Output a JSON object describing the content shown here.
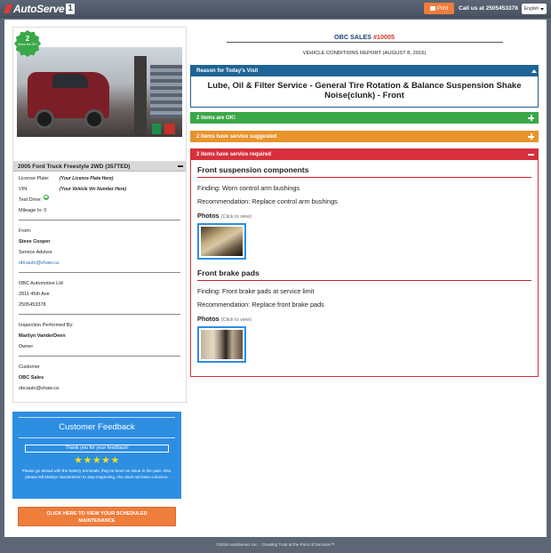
{
  "header": {
    "logo_text": "AutoServe",
    "logo_badge": "1",
    "print_label": "Print",
    "call_text": "Call us at 2505453378",
    "language": "English"
  },
  "vehicle_photo": {
    "ok_badge_count": "2",
    "ok_badge_text": "items are OK!"
  },
  "vehicle": {
    "title": "2005 Ford Truck Freestyle 2WD (357TED)",
    "license_label": "License Plate:",
    "license_value": "(Your Licence Plate Here)",
    "vin_label": "VIN:",
    "vin_value": "(Your Vehicle Vin Number Here)",
    "test_drive_label": "Test Drive:",
    "mileage_label": "Mileage In: 0",
    "from_label": "From:",
    "advisor_name": "Steve Cooper",
    "advisor_role": "Service Advisor",
    "advisor_email": "obcauto@shaw.ca",
    "shop_name": "OBC Automotive Ltd",
    "shop_address": "2811 45th Ave",
    "shop_phone": "2505453378",
    "inspector_label": "Inspection Performed By:",
    "inspector_name": "Marilyn VanderDeen",
    "inspector_role": "Owner",
    "customer_label": "Customer",
    "customer_name": "OBC Sales",
    "customer_email": "obcauto@shaw.ca"
  },
  "feedback": {
    "title": "Customer Feedback",
    "thanks": "Thank you for your feedback!",
    "stars": "★★★★★",
    "rating": 5,
    "message": "Please go ahead with the battery terminals, they've been an issue in the past. Also, please tell Marilyn VanderDeen to stop inspecting, she does not have a licence."
  },
  "maintenance_button": {
    "line1": "CLICK HERE TO VIEW YOUR SCHEDULED",
    "line2": "MAINTENANCE"
  },
  "report": {
    "title_prefix": "OBC SALES",
    "title_number": "#10005",
    "subtitle": "VEHICLE CONDITIONS REPORT (AUGUST 8, 2016)"
  },
  "reason": {
    "header": "Reason for Today's Visit",
    "text_line1": "Lube, Oil & Filter Service - General Tire Rotation & Balance Suspension Shake",
    "text_line2": "Noise(clunk) - Front"
  },
  "sections": {
    "ok": "2 items are OK!",
    "suggested": "2 items have service suggested",
    "required": "2 items have service required"
  },
  "items": [
    {
      "title": "Front suspension components",
      "finding": "Finding: Worn control arm bushings",
      "recommendation": "Recommendation: Replace control arm bushings",
      "photos_label": "Photos",
      "photos_hint": "(Click to view)"
    },
    {
      "title": "Front brake pads",
      "finding": "Finding: Front brake pads at service limit",
      "recommendation": "Recommendation: Replace front brake pads",
      "photos_label": "Photos",
      "photos_hint": "(Click to view)"
    }
  ],
  "footer": {
    "text": "©2016 AutoServe1 Inc. - Creating Trust at the Point of Decision™"
  },
  "colors": {
    "reason": "#1f6496",
    "ok": "#3aa848",
    "suggested": "#e8932c",
    "required": "#d7303c",
    "accent": "#ef7d3c",
    "feedback": "#2d8ee2"
  }
}
